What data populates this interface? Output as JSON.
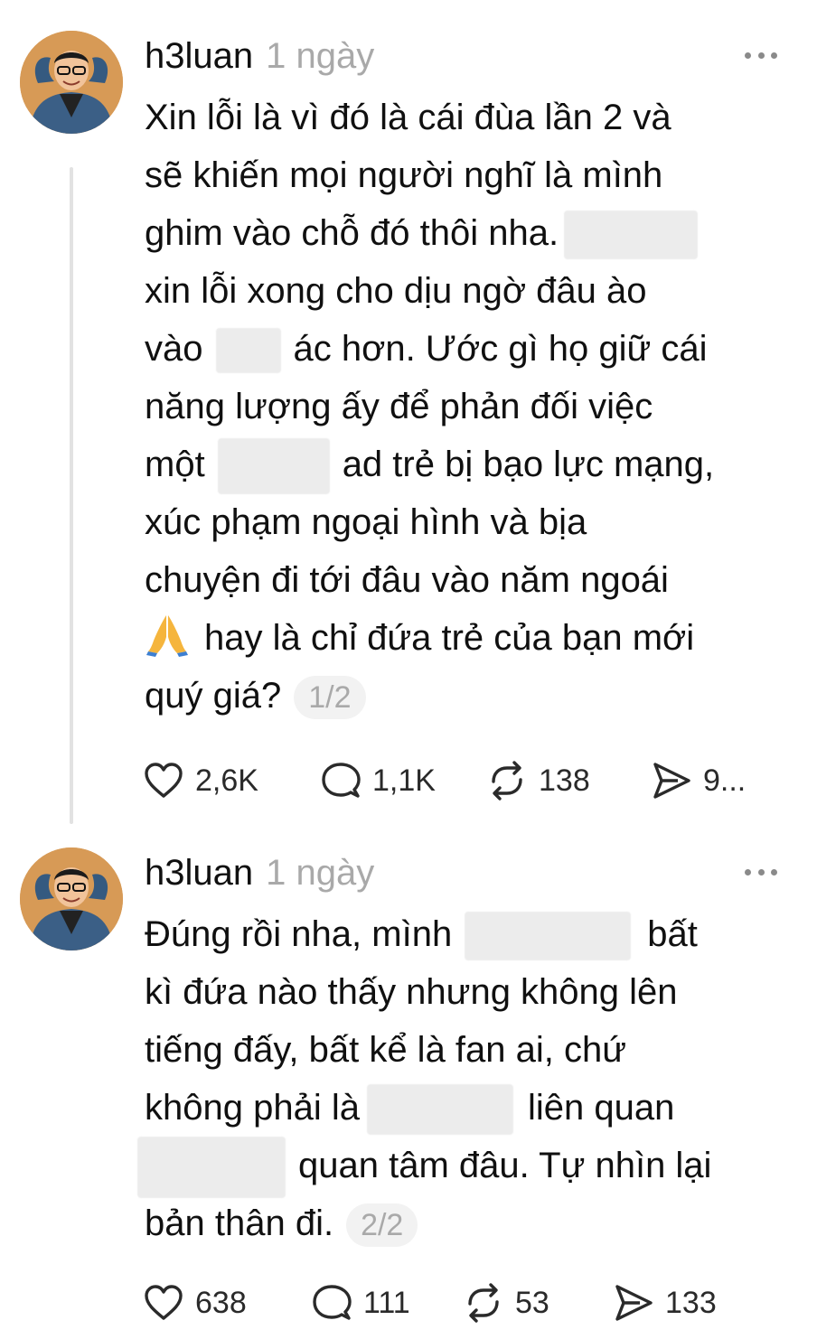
{
  "posts": [
    {
      "username": "h3luan",
      "time": "1 ngày",
      "lines": [
        [
          "Xin lỗi là vì đó là cái đùa lần 2 và"
        ],
        [
          "sẽ khiến mọi người nghĩ là mình"
        ],
        [
          "ghim vào chỗ đó thôi nha."
        ],
        [
          "xin lỗi xong cho dịu ngờ đâu ào"
        ],
        [
          "vào",
          "ác hơn. Ước gì họ giữ cái"
        ],
        [
          "năng lượng ấy để phản đối việc"
        ],
        [
          "một",
          "ad trẻ bị bạo lực mạng,"
        ],
        [
          "xúc phạm ngoại hình và bịa"
        ],
        [
          "chuyện đi tới đâu vào năm ngoái"
        ],
        [
          "hay là chỉ đứa trẻ của bạn mới"
        ],
        [
          "quý giá?"
        ]
      ],
      "pager": "1/2",
      "likes": "2,6K",
      "replies": "1,1K",
      "reposts": "138",
      "shares": "9..."
    },
    {
      "username": "h3luan",
      "time": "1 ngày",
      "lines": [
        [
          "Đúng rồi nha, mình",
          "bất"
        ],
        [
          "kì đứa nào thấy nhưng không lên"
        ],
        [
          "tiếng đấy, bất kể là fan ai, chứ"
        ],
        [
          "không phải là",
          "liên quan"
        ],
        [
          "quan tâm đâu. Tự nhìn lại"
        ],
        [
          "bản thân đi."
        ]
      ],
      "pager": "2/2",
      "likes": "638",
      "replies": "111",
      "reposts": "53",
      "shares": "133"
    }
  ],
  "icons": {
    "like": "heart-icon",
    "reply": "comment-icon",
    "repost": "repost-icon",
    "share": "share-icon",
    "more": "more-dots-icon",
    "emoji": "folded-hands-emoji"
  }
}
